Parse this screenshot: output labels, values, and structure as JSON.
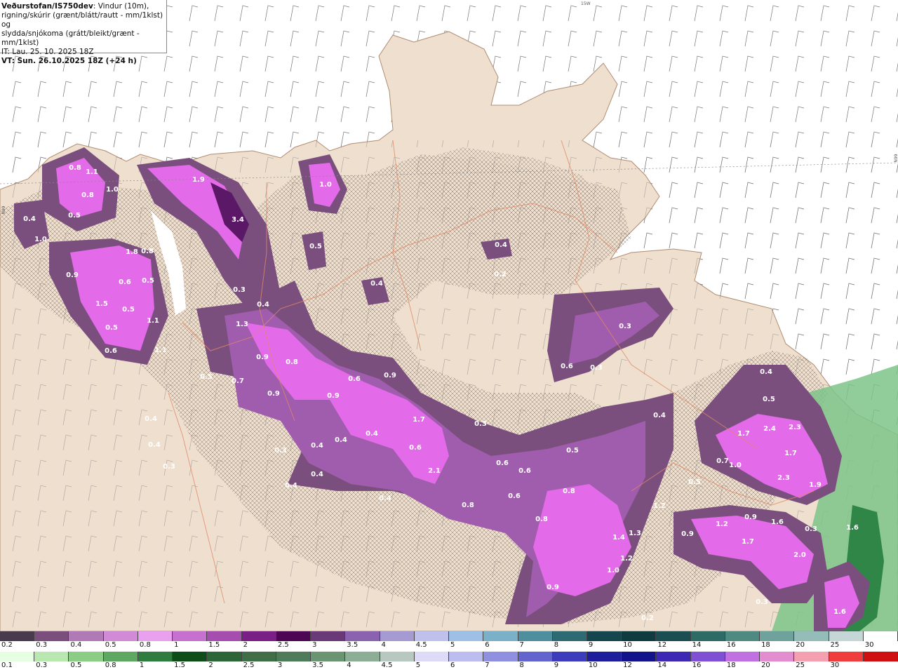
{
  "header": {
    "source": "Veðurstofan/IS750dev",
    "line1": ": Vindur (10m),",
    "line2": "rigning/skúrir (grænt/blátt/rautt - mm/1klst) og",
    "line3": "slydda/snjókoma (grátt/bleikt/grænt - mm/1klst)",
    "it": "IT: Lau. 25. 10. 2025 18Z",
    "vt": "VT: Sun. 26.10.2025 18Z (+24 h)"
  },
  "coords": {
    "top_lon": "15W",
    "right_lat": "66N",
    "left_lat": "66N"
  },
  "colors": {
    "land": "#efdfcf",
    "sea": "#ffffff",
    "precip_light": "#7a4f7e",
    "precip_mid": "#a05cad",
    "precip_high": "#e36ae8",
    "precip_peak": "#5a1866",
    "rain_green": "#7cc488",
    "rain_green_dark": "#1e7a3a"
  },
  "precip_labels": [
    {
      "v": "0.8"
    },
    {
      "v": "1.1"
    },
    {
      "v": "1.0"
    },
    {
      "v": "0.8"
    },
    {
      "v": "0.4"
    },
    {
      "v": "0.5"
    },
    {
      "v": "1.0"
    },
    {
      "v": "1.9"
    },
    {
      "v": "3.4"
    },
    {
      "v": "1.0"
    },
    {
      "v": "0.5"
    },
    {
      "v": "0.4"
    },
    {
      "v": "0.4"
    },
    {
      "v": "0.2"
    },
    {
      "v": "1.8"
    },
    {
      "v": "0.8"
    },
    {
      "v": "0.9"
    },
    {
      "v": "0.6"
    },
    {
      "v": "0.5"
    },
    {
      "v": "1.5"
    },
    {
      "v": "0.5"
    },
    {
      "v": "1.1"
    },
    {
      "v": "0.5"
    },
    {
      "v": "0.6"
    },
    {
      "v": "1.1"
    },
    {
      "v": "0.3"
    },
    {
      "v": "0.4"
    },
    {
      "v": "1.3"
    },
    {
      "v": "0.9"
    },
    {
      "v": "0.8"
    },
    {
      "v": "0.5"
    },
    {
      "v": "0.7"
    },
    {
      "v": "0.9"
    },
    {
      "v": "0.4"
    },
    {
      "v": "0.4"
    },
    {
      "v": "0.3"
    },
    {
      "v": "0.4"
    },
    {
      "v": "0.4"
    },
    {
      "v": "0.4"
    },
    {
      "v": "0.4"
    },
    {
      "v": "0.4"
    },
    {
      "v": "0.6"
    },
    {
      "v": "0.9"
    },
    {
      "v": "0.9"
    },
    {
      "v": "1.7"
    },
    {
      "v": "0.6"
    },
    {
      "v": "0.3"
    },
    {
      "v": "2.1"
    },
    {
      "v": "0.6"
    },
    {
      "v": "0.6"
    },
    {
      "v": "0.6"
    },
    {
      "v": "0.8"
    },
    {
      "v": "0.5"
    },
    {
      "v": "0.4"
    },
    {
      "v": "0.8"
    },
    {
      "v": "0.8"
    },
    {
      "v": "1.2"
    },
    {
      "v": "1.4"
    },
    {
      "v": "1.3"
    },
    {
      "v": "1.2"
    },
    {
      "v": "1.0"
    },
    {
      "v": "0.9"
    },
    {
      "v": "0.4"
    },
    {
      "v": "0.3"
    },
    {
      "v": "0.6"
    },
    {
      "v": "0.3"
    },
    {
      "v": "0.4"
    },
    {
      "v": "0.5"
    },
    {
      "v": "1.7"
    },
    {
      "v": "2.4"
    },
    {
      "v": "2.3"
    },
    {
      "v": "1.7"
    },
    {
      "v": "0.7"
    },
    {
      "v": "1.0"
    },
    {
      "v": "2.3"
    },
    {
      "v": "1.9"
    },
    {
      "v": "0.5"
    },
    {
      "v": "1.2"
    },
    {
      "v": "0.9"
    },
    {
      "v": "1.6"
    },
    {
      "v": "0.9"
    },
    {
      "v": "1.7"
    },
    {
      "v": "0.3"
    },
    {
      "v": "2.0"
    },
    {
      "v": "1.6"
    },
    {
      "v": "0.3"
    },
    {
      "v": "1.6"
    },
    {
      "v": "0.2"
    },
    {
      "v": "0.3"
    }
  ],
  "legend_top": {
    "ticks": [
      "0.2",
      "0.3",
      "0.4",
      "0.5",
      "0.8",
      "1",
      "1.5",
      "2",
      "2.5",
      "3",
      "3.5",
      "4",
      "4.5",
      "5",
      "6",
      "7",
      "8",
      "9",
      "10",
      "12",
      "14",
      "16",
      "18",
      "20",
      "25",
      "30"
    ],
    "colors": [
      "#4a3a4e",
      "#7a4f7e",
      "#b07ab6",
      "#d08ad6",
      "#e9a0ee",
      "#c670cf",
      "#a54eaf",
      "#7a1f86",
      "#4c0654",
      "#6a3a78",
      "#8a62b0",
      "#a69ad2",
      "#c0c0ec",
      "#9ec0e6",
      "#7ab0c8",
      "#4e8e9e",
      "#2e6a74",
      "#15454e",
      "#0e3a40",
      "#1a4e52",
      "#2e6a66",
      "#4e8a82",
      "#6fa29c",
      "#94bcb8",
      "#c4d6d6",
      "#ffffff"
    ]
  },
  "legend_bottom": {
    "ticks": [
      "0.1",
      "0.3",
      "0.5",
      "0.8",
      "1",
      "1.5",
      "2",
      "2.5",
      "3",
      "3.5",
      "4",
      "4.5",
      "5",
      "6",
      "7",
      "8",
      "9",
      "10",
      "12",
      "14",
      "16",
      "18",
      "20",
      "25",
      "30"
    ],
    "colors": [
      "#e6ffe2",
      "#b9e7b0",
      "#8ccd86",
      "#5ea862",
      "#2f7c3e",
      "#0f4d18",
      "#2c6636",
      "#406e46",
      "#4e7c5a",
      "#6a9472",
      "#8cae94",
      "#b6c8c0",
      "#dcdcf8",
      "#bcbcf0",
      "#9090e0",
      "#6464cf",
      "#3c3cbc",
      "#1e1e9c",
      "#12128a",
      "#3c28b4",
      "#8050d4",
      "#c070e0",
      "#e48cd0",
      "#f4a0b0",
      "#f03c3c",
      "#d01010"
    ]
  }
}
